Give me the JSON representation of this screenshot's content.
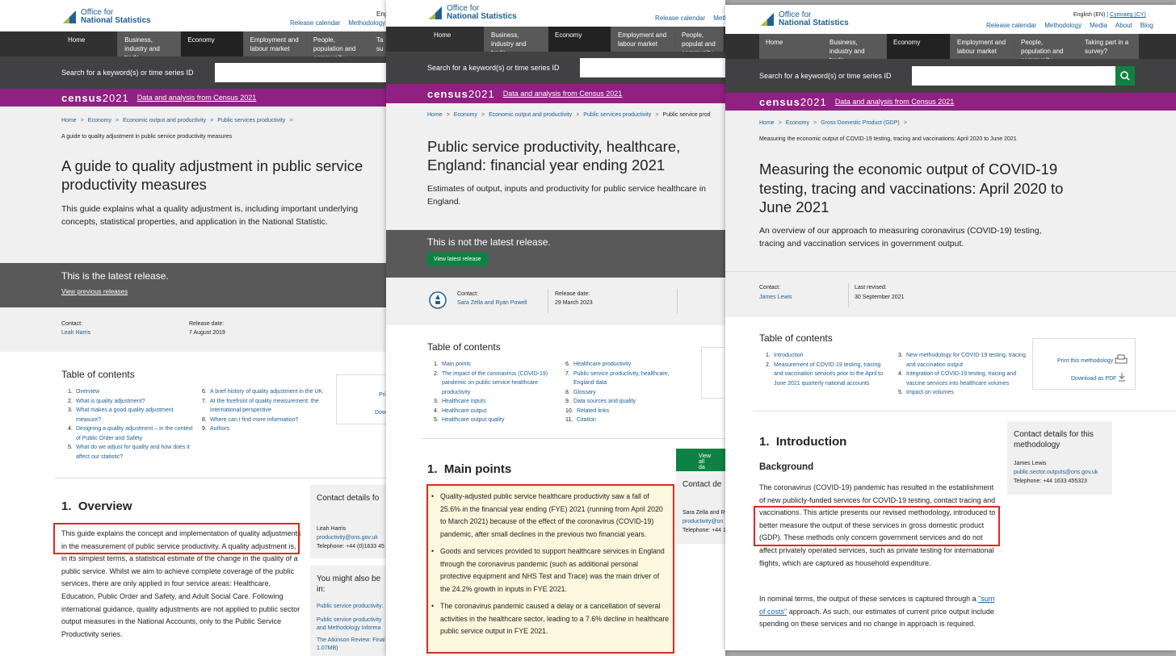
{
  "brand": {
    "line1": "Office for",
    "line2": "National Statistics"
  },
  "header_links": {
    "release_calendar": "Release calendar",
    "methodology": "Methodology",
    "media": "Media",
    "about": "About",
    "blog": "Blog",
    "english": "English (EN)",
    "cymraeg": "Cymraeg (CY)",
    "lang_trunc": "Engl",
    "m_trunc": "M"
  },
  "nav": {
    "home": "Home",
    "business": "Business, industry and trade",
    "economy": "Economy",
    "employment": "Employment and labour market",
    "people": "People, population and community",
    "people_trunc": "People, populat and community",
    "taking": "Taking part in a survey?",
    "taking_trunc": "Ta su"
  },
  "search": {
    "label": "Search for a keyword(s) or time series ID"
  },
  "census": {
    "brand_a": "census",
    "brand_b": "2021",
    "link": "Data and analysis from Census 2021"
  },
  "colors": {
    "ons_blue": "#206095",
    "nav_dark": "#323132",
    "census_purple": "#902082",
    "green": "#0f8243",
    "highlight_red": "#e0281c"
  },
  "p1": {
    "crumbs": [
      "Home",
      "Economy",
      "Economic output and productivity",
      "Public services productivity"
    ],
    "crumb_current": "A guide to quality adjustment in public service productivity measures",
    "title": "A guide to quality adjustment in public service productivity measures",
    "lede": "This guide explains what a quality adjustment is, including important underlying concepts, statistical properties, and application in the National Statistic.",
    "latest": "This is the latest release.",
    "previous": "View previous releases",
    "contact_label": "Contact:",
    "contact_name": "Leah Harris",
    "release_label": "Release date:",
    "release_date": "7 August 2019",
    "toc_title": "Table of contents",
    "toc_left": [
      {
        "n": "1.",
        "t": "Overview"
      },
      {
        "n": "2.",
        "t": "What is quality adjustment?"
      },
      {
        "n": "3.",
        "t": "What makes a good quality adjustment measure?"
      },
      {
        "n": "4.",
        "t": "Designing a quality adjustment – in the context of Public Order and Safety"
      },
      {
        "n": "5.",
        "t": "What do we adjust for quality and how does it affect our statistic?"
      }
    ],
    "toc_right": [
      {
        "n": "6.",
        "t": "A brief history of quality adjustment in the UK"
      },
      {
        "n": "7.",
        "t": "At the forefront of quality measurement: the international perspective"
      },
      {
        "n": "8.",
        "t": "Where can I find more information?"
      },
      {
        "n": "9.",
        "t": "Authors"
      }
    ],
    "print_trunc": "Pri",
    "download_trunc": "Dow",
    "section_num": "1.",
    "section_title": "Overview",
    "para": "This guide explains the concept and implementation of quality adjustments in the measurement of public service productivity. A quality adjustment is, in its simplest terms, a statistical estimate of the change in the quality of a public service. Whilst we aim to achieve complete coverage of the public services, there are only applied in four service areas: Healthcare, Education, Public Order and Safety, and Adult Social Care. Following international guidance, quality adjustments are not applied to public sector output measures in the National Accounts, only to the Public Service Productivity series.",
    "sidebox_title": "Contact details fo",
    "side_name": "Leah Harris",
    "side_email": "productivity@ons.gov.uk",
    "side_tel": "Telephone: +44 (0)1633 45",
    "also_title": "You might also be in:",
    "also_links": [
      "Public service productivity:",
      "Public service productivity and Methodology Informa",
      "The Atkinson Review: Final 1.07MB)"
    ]
  },
  "p2": {
    "crumbs": [
      "Home",
      "Economy",
      "Economic output and productivity",
      "Public services productivity"
    ],
    "crumb_current": "Public service prod",
    "title": "Public service productivity, healthcare, England: financial year ending 2021",
    "lede": "Estimates of output, inputs and productivity for public service healthcare in England.",
    "not_latest": "This is not the latest release.",
    "view_latest": "View latest release",
    "contact_label": "Contact:",
    "contact_name": "Sara Zella and Ryan Powell",
    "release_label": "Release date:",
    "release_date": "29 March 2023",
    "toc_title": "Table of contents",
    "toc_left": [
      {
        "n": "1.",
        "t": "Main points"
      },
      {
        "n": "2.",
        "t": "The impact of the coronavirus (COVID-19) pandemic on public service healthcare productivity"
      },
      {
        "n": "3.",
        "t": "Healthcare inputs"
      },
      {
        "n": "4.",
        "t": "Healthcare output"
      },
      {
        "n": "5.",
        "t": "Healthcare output quality"
      }
    ],
    "toc_right": [
      {
        "n": "6.",
        "t": "Healthcare productivity"
      },
      {
        "n": "7.",
        "t": "Public service productivity, healthcare, England data"
      },
      {
        "n": "8.",
        "t": "Glossary"
      },
      {
        "n": "9.",
        "t": "Data sources and quality"
      },
      {
        "n": "10.",
        "t": "Related links"
      },
      {
        "n": "11.",
        "t": "Citation"
      }
    ],
    "view_all": "View all da",
    "section_num": "1.",
    "section_title": "Main points",
    "points": [
      "Quality-adjusted public service healthcare productivity saw a fall of 25.6% in the financial year ending (FYE) 2021 (running from April 2020 to March 2021) because of the effect of the coronavirus (COVID-19) pandemic, after small declines in the previous two financial years.",
      "Goods and services provided to support healthcare services in England through the coronavirus pandemic (such as additional personal protective equipment and NHS Test and Trace) was the main driver of the 24.2% growth in inputs in FYE 2021.",
      "The coronavirus pandemic caused a delay or a cancellation of several activities in the healthcare sector, leading to a 7.6% decline in healthcare public service output in FYE 2021."
    ],
    "sidebox_title": "Contact de",
    "side_name": "Sara Zella and Ry",
    "side_email": "productivity@on",
    "side_tel": "Telephone: +44 1"
  },
  "p3": {
    "crumbs": [
      "Home",
      "Economy",
      "Gross Domestic Product (GDP)"
    ],
    "crumb_current": "Measuring the economic output of COVID-19 testing, tracing and vaccinations: April 2020 to June 2021",
    "title": "Measuring the economic output of COVID-19 testing, tracing and vaccinations: April 2020 to June 2021",
    "lede": "An overview of our approach to measuring coronavirus (COVID-19) testing, tracing and vaccination services in government output.",
    "contact_label": "Contact:",
    "contact_name": "James Lewis",
    "revised_label": "Last revised:",
    "revised_date": "30 September 2021",
    "toc_title": "Table of contents",
    "toc_left": [
      {
        "n": "1.",
        "t": "Introduction"
      },
      {
        "n": "2.",
        "t": "Measurement of COVID-19 testing, tracing and vaccination services prior to the April to June 2021 quarterly national accounts"
      }
    ],
    "toc_right": [
      {
        "n": "3.",
        "t": "New methodology for COVID-19 testing, tracing and vaccination output"
      },
      {
        "n": "4.",
        "t": "Integration of COVID-19 testing, tracing and vaccine services into healthcare volumes"
      },
      {
        "n": "5.",
        "t": "Impact on volumes"
      }
    ],
    "print": "Print this methodology",
    "download": "Download as PDF",
    "section_num": "1.",
    "section_title": "Introduction",
    "sub": "Background",
    "para1": "The coronavirus (COVID-19) pandemic has resulted in the establishment of new publicly-funded services for COVID-19 testing, contact tracing and vaccinations. This article presents our revised methodology, introduced to better measure the output of these services in gross domestic product (GDP). These methods only concern government services and do not affect privately operated services, such as private testing for international flights, which are captured as household expenditure.",
    "para2_a": "In nominal terms, the output of these services is captured through a ",
    "para2_link": "\"sum of costs\"",
    "para2_b": " approach. As such, our estimates of current price output include spending on these services and no change in approach is required.",
    "sidebox_title": "Contact details for this methodology",
    "side_name": "James Lewis",
    "side_email": "public.sector.outputs@ons.gov.uk",
    "side_tel": "Telephone: +44 1633 455323"
  }
}
